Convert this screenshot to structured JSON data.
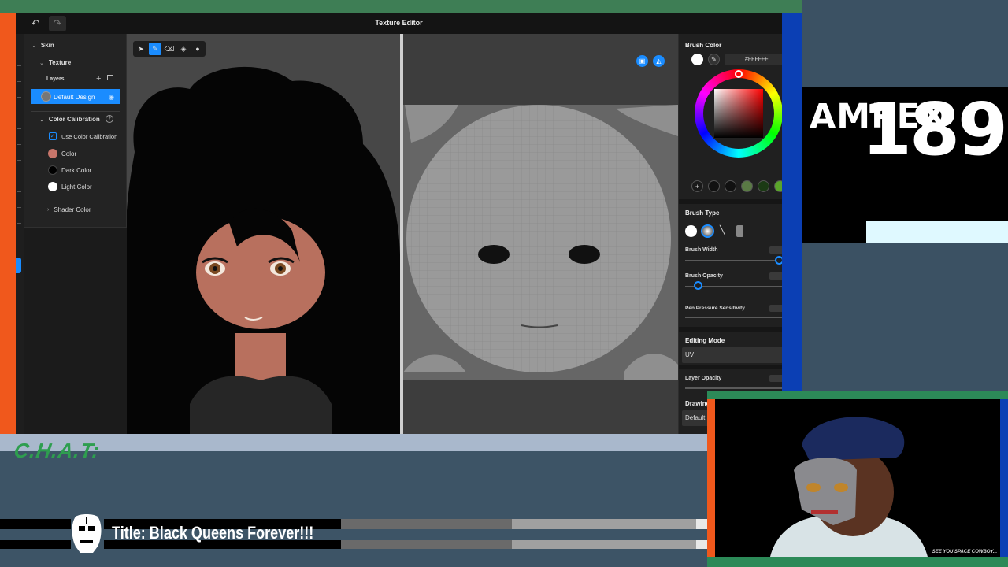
{
  "window": {
    "title": "Texture Editor"
  },
  "layers_panel": {
    "skin_label": "Skin",
    "texture_label": "Texture",
    "layers_label": "Layers",
    "selected_layer": "Default Design",
    "color_calibration_label": "Color Calibration",
    "use_color_calibration_label": "Use Color Calibration",
    "use_color_calibration_checked": true,
    "color_label": "Color",
    "dark_color_label": "Dark Color",
    "light_color_label": "Light Color",
    "shader_color_label": "Shader Color",
    "colors": {
      "color": "#c7756a",
      "dark_color": "#000000",
      "light_color": "#ffffff"
    }
  },
  "properties": {
    "brush_color_label": "Brush Color",
    "hex_value": "#FFFFFF",
    "brush_type_label": "Brush Type",
    "brush_width_label": "Brush Width",
    "brush_opacity_label": "Brush Opacity",
    "pen_pressure_label": "Pen Pressure Sensitivity",
    "editing_mode_label": "Editing Mode",
    "editing_mode_value": "UV",
    "layer_opacity_label": "Layer Opacity",
    "drawing_mode_label": "Drawing Mode",
    "drawing_mode_value": "Default",
    "palette_colors": [
      "#1a1a1a",
      "#111111",
      "#111111",
      "#5a7a45",
      "#1b3a14",
      "#5aa42a"
    ],
    "brush_width_fraction": 1.0,
    "brush_opacity_fraction": 0.12
  },
  "overlay": {
    "chat_label": "C.H.A.T:",
    "stream_title": "Title: Black Queens Forever!!!",
    "brand": "AMPEX",
    "number": "189",
    "progress_fraction": 0.69,
    "cam_caption": "SEE YOU SPACE COWBOY..."
  },
  "colors": {
    "accent": "#1a8cff",
    "orange": "#f0581c",
    "green": "#3e7e55",
    "navy": "#0b3fb4"
  }
}
